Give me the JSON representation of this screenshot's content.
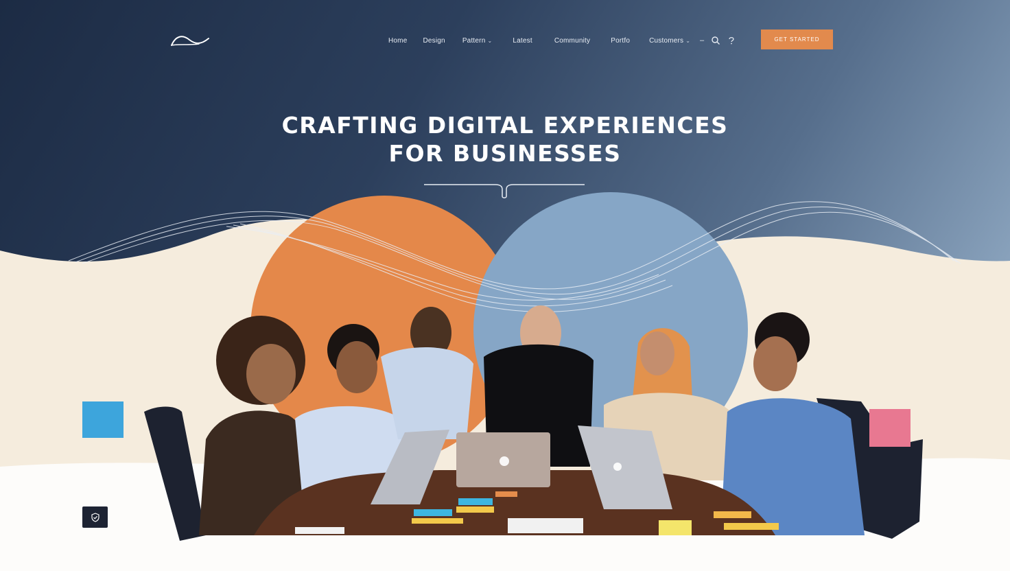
{
  "header": {
    "logo_icon": "wave-logo-icon",
    "nav": [
      {
        "label": "Home",
        "has_dropdown": false
      },
      {
        "label": "Design",
        "has_dropdown": false
      },
      {
        "label": "Pattern",
        "has_dropdown": true
      },
      {
        "label": "Latest",
        "has_dropdown": false
      },
      {
        "label": "Community",
        "has_dropdown": false
      },
      {
        "label": "Portfo",
        "has_dropdown": false
      },
      {
        "label": "Customers",
        "has_dropdown": true
      }
    ],
    "tools": {
      "dash": "–",
      "search_icon": "search-icon",
      "help_icon": "help-icon"
    },
    "cta_label": "GET STARTED"
  },
  "hero": {
    "headline_line1": "CRAFTING DIGITAL EXPERIENCES",
    "headline_line2": "FOR BUSINESSES"
  },
  "decor": {
    "badge_icon": "shield-check-icon"
  },
  "colors": {
    "navy": "#1c2b44",
    "accent_orange": "#e28a4d",
    "accent_blue": "#3da5dc",
    "accent_pink": "#e87891",
    "cream": "#f5ecdd",
    "slate_blue": "#86a6c6"
  }
}
